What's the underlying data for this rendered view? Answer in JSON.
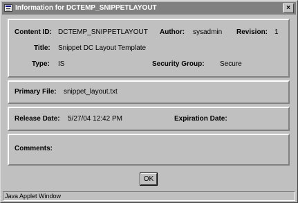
{
  "window": {
    "title": "Information for DCTEMP_SNIPPETLAYOUT",
    "close_glyph": "×"
  },
  "details": {
    "content_id_label": "Content ID:",
    "content_id_value": "DCTEMP_SNIPPETLAYOUT",
    "author_label": "Author:",
    "author_value": "sysadmin",
    "revision_label": "Revision:",
    "revision_value": "1",
    "title_label": "Title:",
    "title_value": "Snippet DC Layout Template",
    "type_label": "Type:",
    "type_value": "IS",
    "security_group_label": "Security Group:",
    "security_group_value": "Secure"
  },
  "file": {
    "primary_file_label": "Primary File:",
    "primary_file_value": "snippet_layout.txt"
  },
  "dates": {
    "release_date_label": "Release Date:",
    "release_date_value": "5/27/04 12:42 PM",
    "expiration_date_label": "Expiration Date:",
    "expiration_date_value": ""
  },
  "comments": {
    "comments_label": "Comments:",
    "comments_value": ""
  },
  "buttons": {
    "ok_label": "OK"
  },
  "status": {
    "text": "Java Applet Window"
  },
  "colors": {
    "titlebar_bg": "#808080",
    "window_bg": "#c0c0c0"
  },
  "icons": {
    "title_icon": "window-icon",
    "close_icon": "close-icon"
  }
}
